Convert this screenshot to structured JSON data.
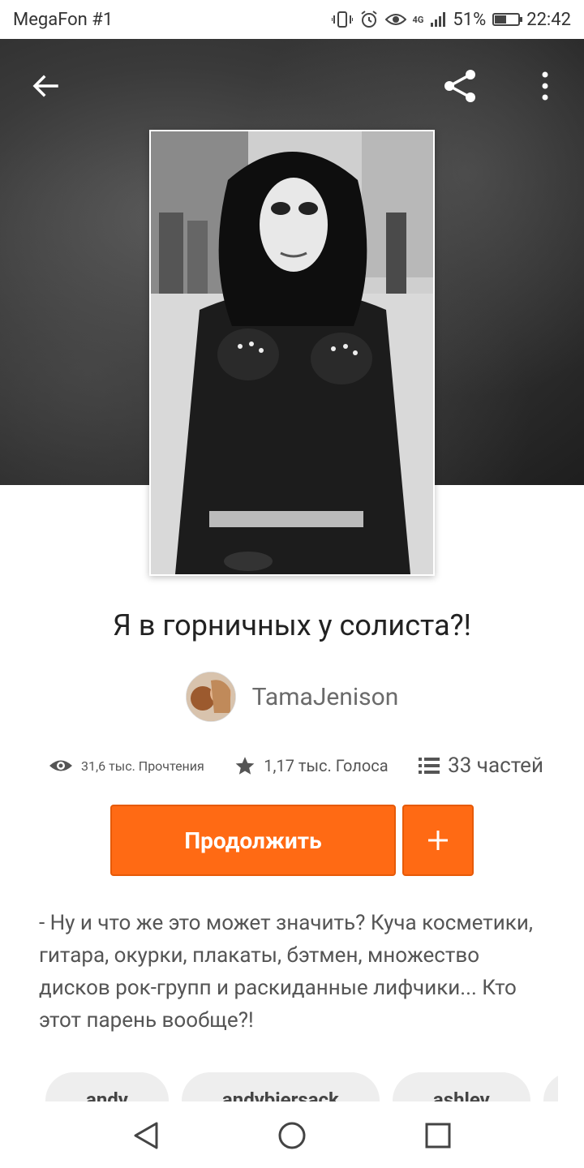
{
  "status_bar": {
    "carrier": "MegaFon #1",
    "network": "4G",
    "battery_percent": "51%",
    "battery_level": 0.51,
    "time": "22:42",
    "icons": [
      "vibrate-icon",
      "alarm-icon",
      "eye-icon",
      "signal-icon",
      "battery-icon"
    ]
  },
  "toolbar": {
    "back_icon": "arrow-left-icon",
    "share_icon": "share-icon",
    "more_icon": "more-vertical-icon"
  },
  "story": {
    "title": "Я в горничных у солиста?!",
    "author": "TamaJenison",
    "stats": {
      "reads": "31,6 тыс. Прочтения",
      "votes": "1,17 тыс. Голоса",
      "parts": "33 частей"
    },
    "continue_label": "Продолжить",
    "add_label": "+",
    "description": "- Ну и что же это может значить? Куча косметики, гитара, окурки, плакаты, бэтмен, множество дисков рок-групп и раскиданные лифчики... Кто этот парень вообще?!",
    "tags": [
      "andy",
      "andybiersack",
      "ashley",
      "a"
    ]
  },
  "colors": {
    "accent": "#ff6a14",
    "accent_border": "#e65a08",
    "hero_bg": "#2e2e2e"
  }
}
